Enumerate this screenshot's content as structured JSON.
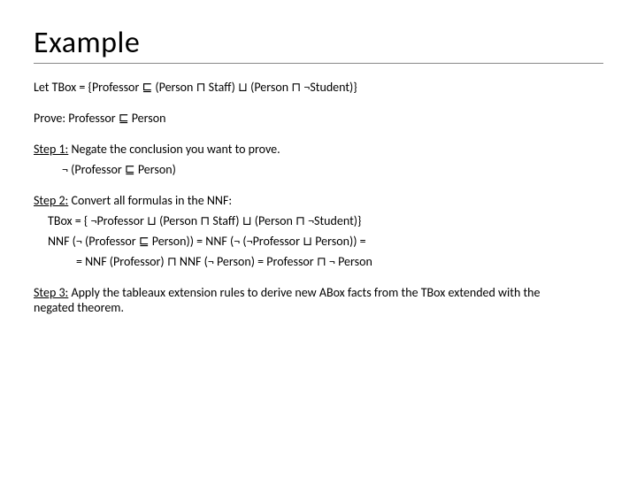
{
  "title": "Example",
  "tbox_line": "Let TBox = {Professor ⊑ (Person ⊓ Staff) ⊔ (Person ⊓ ¬Student)}",
  "prove_line": "Prove:  Professor ⊑ Person",
  "step1_label": "Step 1:",
  "step1_text": "  Negate the conclusion you want to prove.",
  "step1_formula": "¬ (Professor ⊑ Person)",
  "step2_label": "Step 2:",
  "step2_text": "  Convert all formulas in the NNF:",
  "step2_line1": "TBox = { ¬Professor ⊔ (Person ⊓ Staff) ⊔ (Person ⊓ ¬Student)}",
  "step2_line2": "NNF (¬ (Professor ⊑ Person)) = NNF (¬ (¬Professor ⊔ Person)) =",
  "step2_line3": "= NNF (Professor) ⊓ NNF (¬ Person) = Professor ⊓ ¬ Person",
  "step3_label": "Step 3:",
  "step3_text": "  Apply the tableaux extension rules to derive new ABox facts from the TBox extended with the negated theorem."
}
